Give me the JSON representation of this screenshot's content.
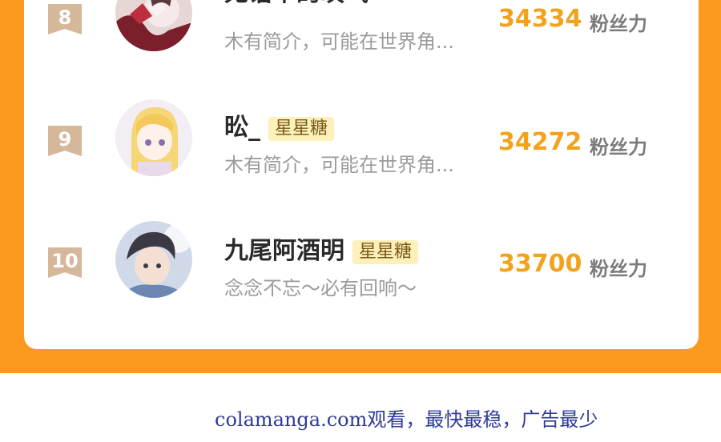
{
  "ranking": [
    {
      "rank": "8",
      "name": "无语中的叹气",
      "badge": "",
      "description": "木有简介，可能在世界角...",
      "score": "34334",
      "unit": "粉丝力"
    },
    {
      "rank": "9",
      "name": "昖_",
      "badge": "星星糖",
      "description": "木有简介，可能在世界角...",
      "score": "34272",
      "unit": "粉丝力"
    },
    {
      "rank": "10",
      "name": "九尾阿酒明",
      "badge": "星星糖",
      "description": "念念不忘～必有回响～",
      "score": "33700",
      "unit": "粉丝力"
    }
  ],
  "footer": {
    "watermark": "colamanga.com观看，最快最稳，广告最少"
  },
  "colors": {
    "accent_orange": "#fb9a1f",
    "score_orange": "#f3a21c",
    "rank_tag": "#d5b79a",
    "badge_bg": "#fdf0b8"
  }
}
